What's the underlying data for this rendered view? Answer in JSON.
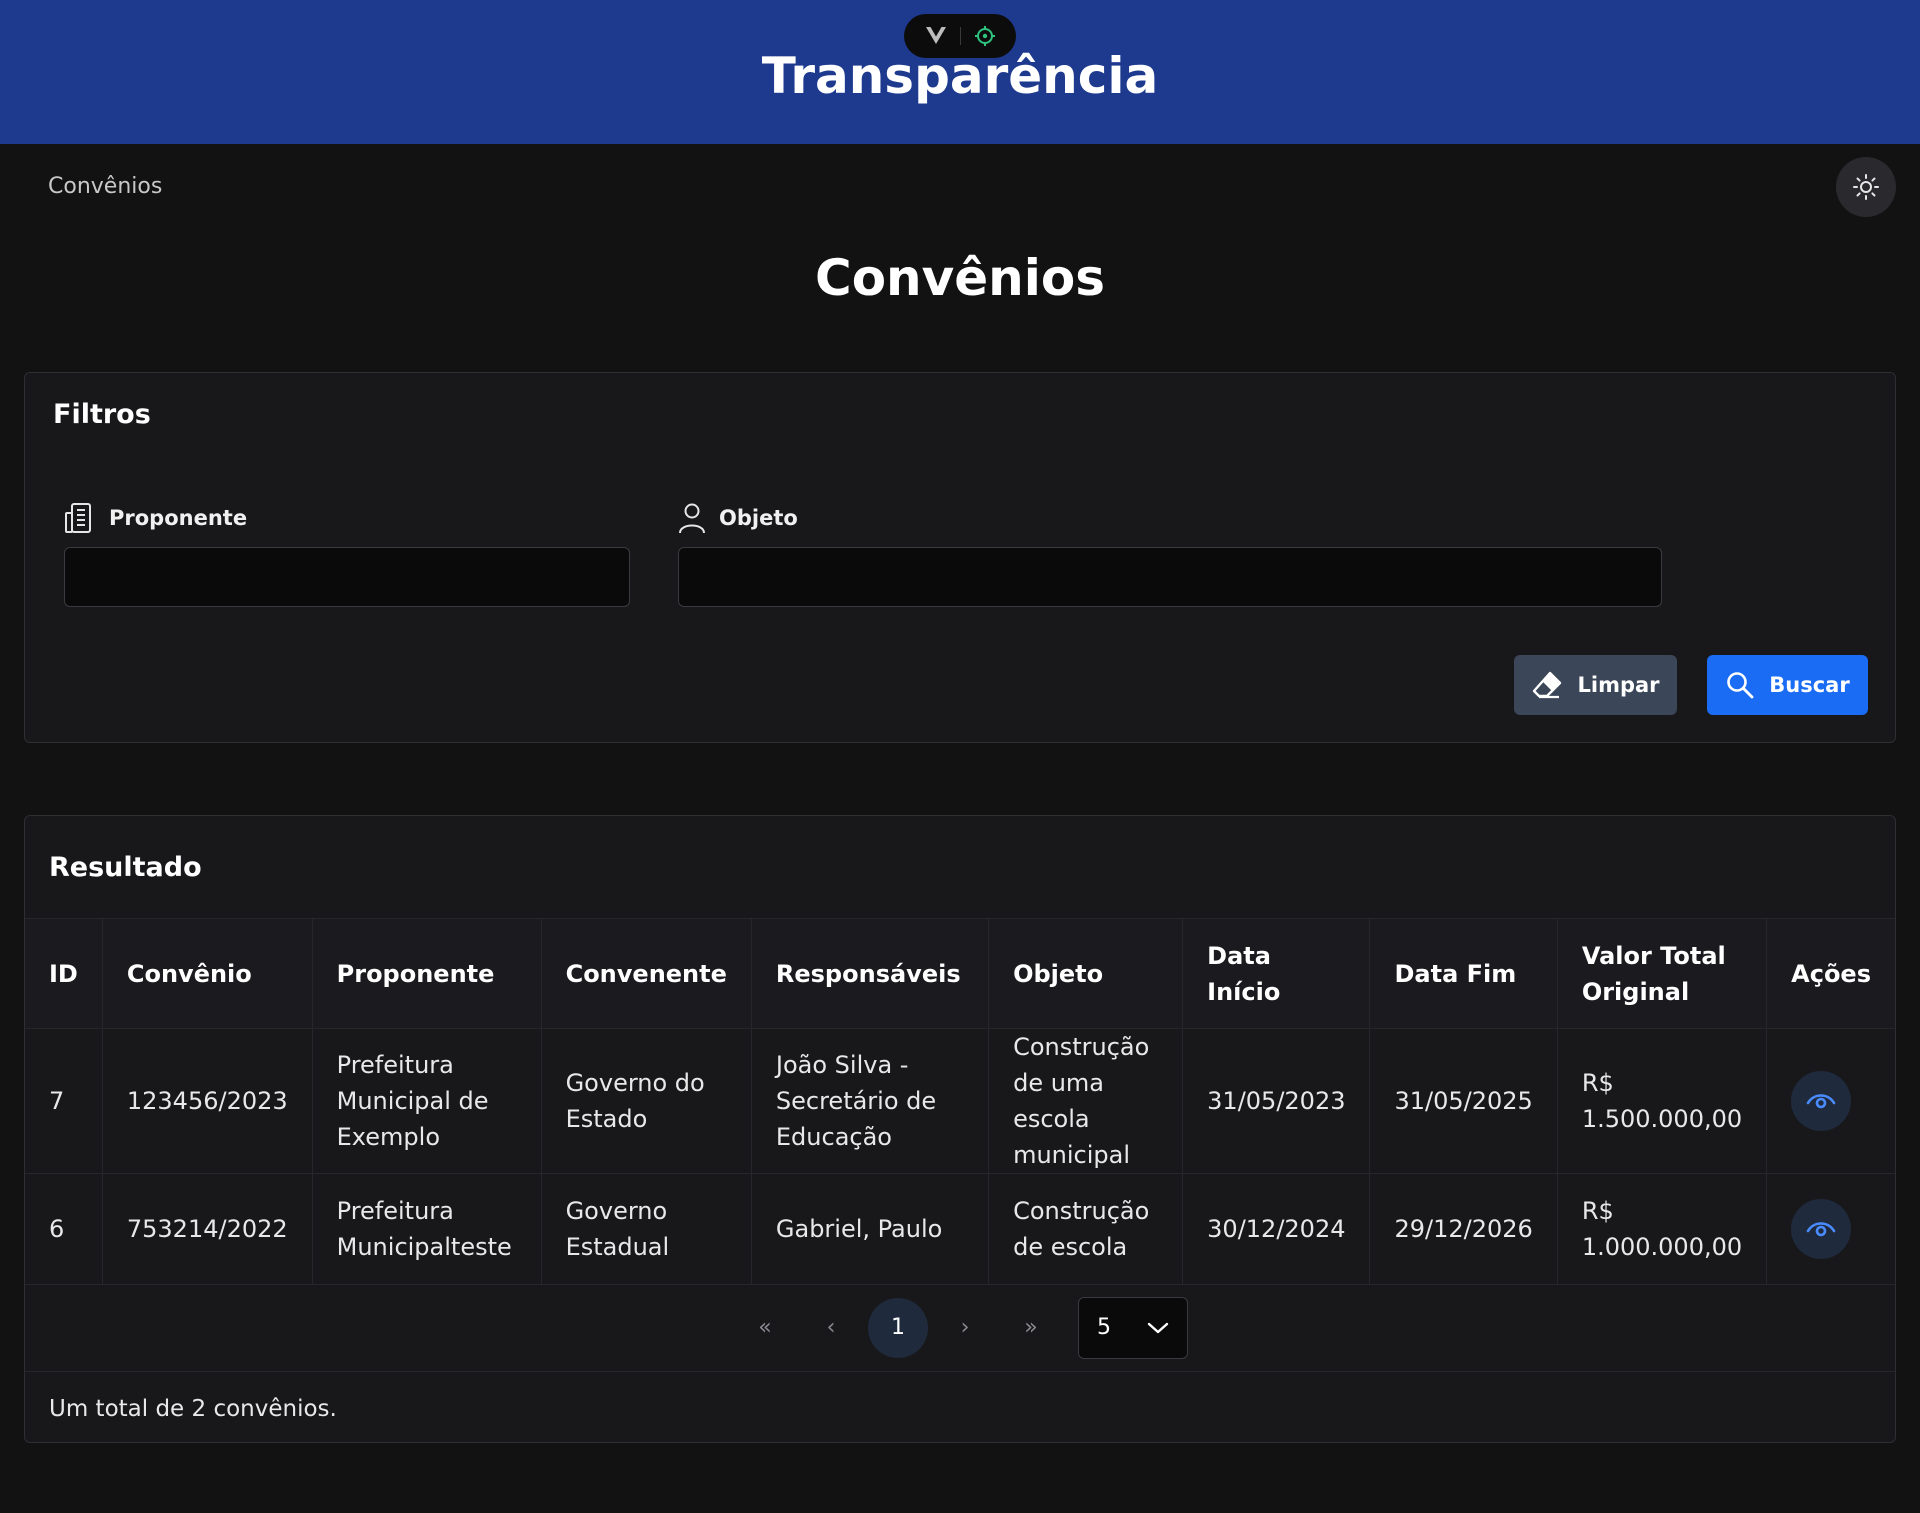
{
  "header": {
    "title": "Transparência"
  },
  "devtools": {
    "logo_letter": "V"
  },
  "breadcrumb": {
    "current": "Convênios"
  },
  "page": {
    "title": "Convênios"
  },
  "filters": {
    "title": "Filtros",
    "proponente_label": "Proponente",
    "objeto_label": "Objeto",
    "proponente_value": "",
    "objeto_value": "",
    "clear_label": "Limpar",
    "search_label": "Buscar"
  },
  "results": {
    "title": "Resultado",
    "columns": [
      "ID",
      "Convênio",
      "Proponente",
      "Convenente",
      "Responsáveis",
      "Objeto",
      "Data Início",
      "Data Fim",
      "Valor Total Original",
      "Ações"
    ],
    "rows": [
      {
        "id": "7",
        "convenio": "123456/2023",
        "proponente": "Prefeitura Municipal de Exemplo",
        "convenente": "Governo do Estado",
        "responsaveis": "João Silva - Secretário de Educação",
        "objeto": "Construção de uma escola municipal",
        "data_inicio": "31/05/2023",
        "data_fim": "31/05/2025",
        "valor": "R$ 1.500.000,00"
      },
      {
        "id": "6",
        "convenio": "753214/2022",
        "proponente": "Prefeitura Municipalteste",
        "convenente": "Governo Estadual",
        "responsaveis": "Gabriel, Paulo",
        "objeto": "Construção de escola",
        "data_inicio": "30/12/2024",
        "data_fim": "29/12/2026",
        "valor": "R$ 1.000.000,00"
      }
    ],
    "pagination": {
      "first": "«",
      "prev": "‹",
      "current_page": "1",
      "next": "›",
      "last": "»",
      "page_size": "5"
    },
    "total_text": "Um total de 2 convênios."
  },
  "icons": {
    "theme": "sun-icon",
    "proponente": "building-icon",
    "objeto": "user-icon",
    "clear": "eraser-icon",
    "search": "search-icon",
    "view": "eye-icon"
  },
  "colors": {
    "header_bg": "#1e3a8f",
    "primary": "#1a6cf5",
    "background": "#121212"
  }
}
